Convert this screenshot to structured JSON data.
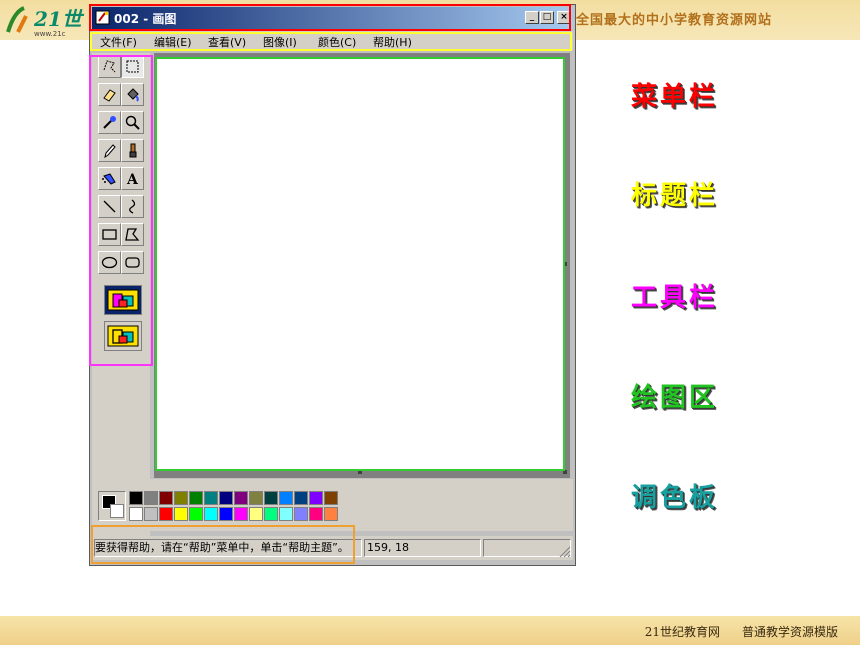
{
  "site": {
    "slogan": "全国最大的中小学教育资源网站",
    "footer_site": "21世纪教育网",
    "footer_template": "普通教学资源模版"
  },
  "window": {
    "title": "002 - 画图",
    "minimize": "_",
    "maximize": "□",
    "close": "×"
  },
  "menu": {
    "items": [
      {
        "label": "文件(F)"
      },
      {
        "label": "编辑(E)"
      },
      {
        "label": "查看(V)"
      },
      {
        "label": "图像(I)"
      },
      {
        "label": "颜色(C)"
      },
      {
        "label": "帮助(H)"
      }
    ]
  },
  "tools": [
    {
      "icon": "free-form-select-icon"
    },
    {
      "icon": "rect-select-icon"
    },
    {
      "icon": "eraser-icon"
    },
    {
      "icon": "fill-bucket-icon"
    },
    {
      "icon": "color-picker-icon"
    },
    {
      "icon": "magnifier-icon"
    },
    {
      "icon": "pencil-icon"
    },
    {
      "icon": "brush-icon"
    },
    {
      "icon": "airbrush-icon"
    },
    {
      "icon": "text-icon",
      "glyph": "A"
    },
    {
      "icon": "line-icon"
    },
    {
      "icon": "curve-icon"
    },
    {
      "icon": "rectangle-icon"
    },
    {
      "icon": "polygon-icon"
    },
    {
      "icon": "ellipse-icon"
    },
    {
      "icon": "rounded-rect-icon"
    }
  ],
  "palette": {
    "top_row": [
      "#000000",
      "#808080",
      "#800000",
      "#808000",
      "#008000",
      "#008080",
      "#000080",
      "#800080",
      "#808040",
      "#004040",
      "#0080ff",
      "#004080",
      "#8000ff",
      "#804000"
    ],
    "bottom_row": [
      "#ffffff",
      "#c0c0c0",
      "#ff0000",
      "#ffff00",
      "#00ff00",
      "#00ffff",
      "#0000ff",
      "#ff00ff",
      "#ffff80",
      "#00ff80",
      "#80ffff",
      "#8080ff",
      "#ff0080",
      "#ff8040"
    ]
  },
  "status": {
    "help_text": "要获得帮助，请在“帮助”菜单中，单击“帮助主题”。",
    "coords": "159, 18"
  },
  "labels": [
    {
      "text": "菜单栏",
      "color": "#ff0000"
    },
    {
      "text": "标题栏",
      "color": "#ffff00"
    },
    {
      "text": "工具栏",
      "color": "#ff00ff"
    },
    {
      "text": "绘图区",
      "color": "#22c422"
    },
    {
      "text": "调色板",
      "color": "#18a0a0"
    }
  ],
  "highlight_colors": {
    "title_bar": "#ff0000",
    "menu_bar": "#ffff33",
    "toolbox": "#ff33ff",
    "canvas": "#33cc33",
    "status": "#f0a030"
  }
}
